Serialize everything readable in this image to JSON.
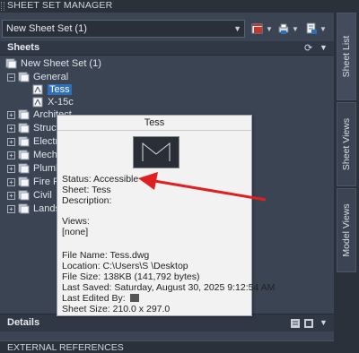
{
  "palette": {
    "background": "#3b4453",
    "selection": "#2f6fb7",
    "tooltip_bg": "#f2f2f2",
    "arrow": "#e02020"
  },
  "panel": {
    "title": "SHEET SET MANAGER"
  },
  "toolbar": {
    "sheet_set_value": "New Sheet Set (1)",
    "icons": [
      "open-sheet-set-icon",
      "publish-icon",
      "sheet-selections-icon"
    ]
  },
  "sheets_section": {
    "label": "Sheets"
  },
  "tree": {
    "root": "New Sheet Set (1)",
    "general": "General",
    "sheets": [
      "Tess",
      "X-15c"
    ],
    "groups": [
      "Architect",
      "Structu",
      "Electri",
      "Mecha",
      "Plumb",
      "Fire Pr",
      "Civil",
      "Landsc"
    ]
  },
  "details": {
    "label": "Details"
  },
  "external_references": {
    "label": "EXTERNAL REFERENCES"
  },
  "side_tabs": [
    "Sheet List",
    "Sheet Views",
    "Model Views"
  ],
  "tooltip": {
    "title": "Tess",
    "status": "Status: Accessible",
    "sheet": "Sheet: Tess",
    "description": "Description:",
    "views_label": "Views:",
    "views_value": "[none]",
    "file_name": "File Name: Tess.dwg",
    "location": "Location: C:\\Users\\S       \\Desktop",
    "file_size": "File Size: 138KB (141,792 bytes)",
    "last_saved": "Last Saved: Saturday, August 30, 2025  9:12:54 AM",
    "last_edited": "Last Edited By:",
    "sheet_size": "Sheet Size: 210.0 x 297.0"
  }
}
